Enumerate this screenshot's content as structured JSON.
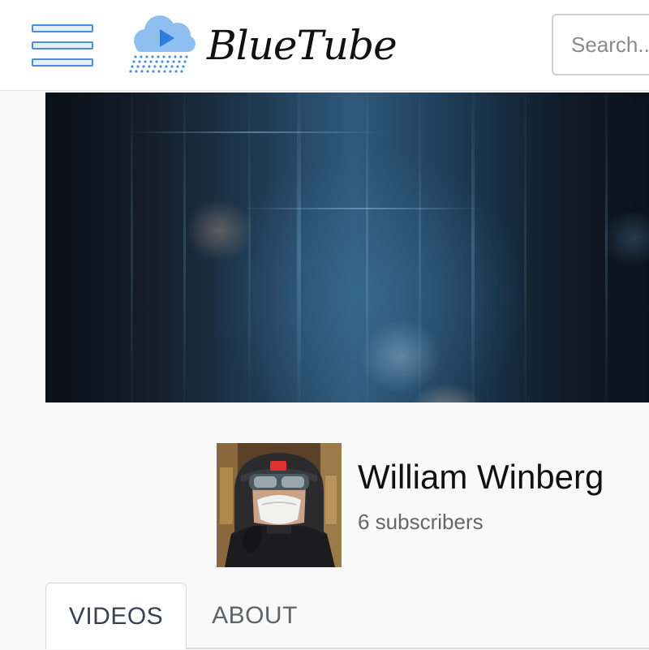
{
  "header": {
    "logo_text": "BlueTube",
    "search_placeholder": "Search..."
  },
  "channel": {
    "name": "William Winberg",
    "subscribers": "6 subscribers"
  },
  "tabs": [
    {
      "label": "VIDEOS",
      "active": true
    },
    {
      "label": "ABOUT",
      "active": false
    }
  ],
  "icons": {
    "menu": "hamburger-menu-icon",
    "logo": "cloud-play-rain-icon"
  },
  "colors": {
    "accent": "#4a8fdc",
    "logo_cloud": "#7fb3ea",
    "play_triangle": "#3b82e0",
    "page_bg": "#f9f9f9"
  }
}
